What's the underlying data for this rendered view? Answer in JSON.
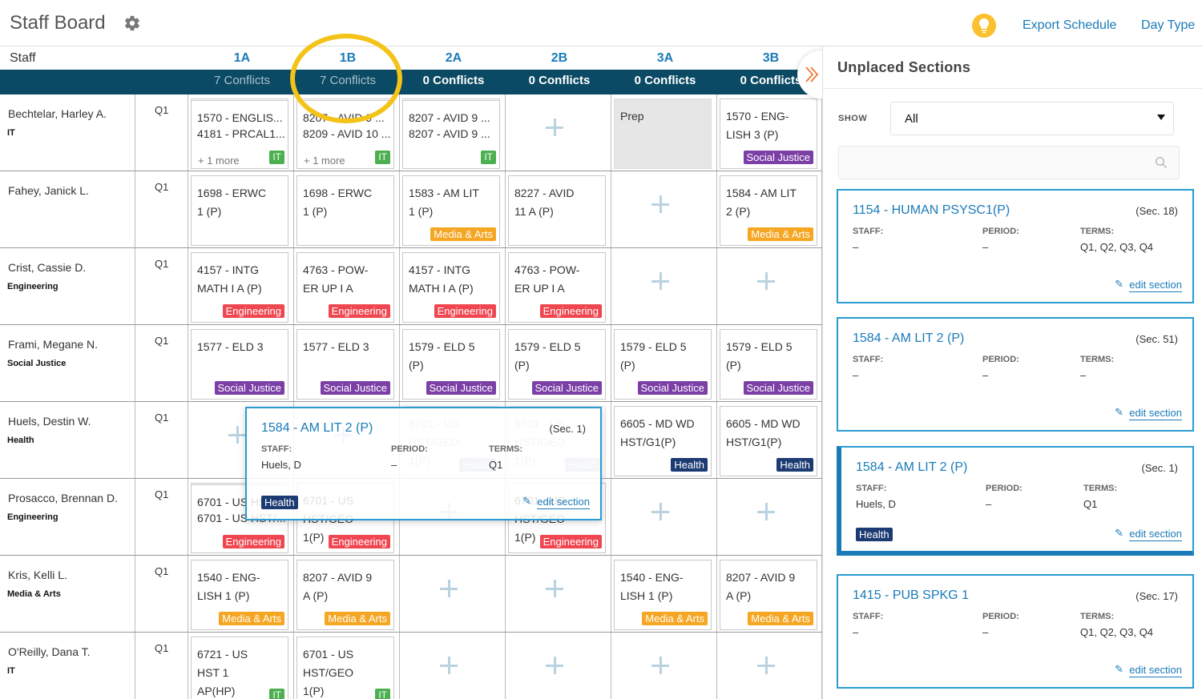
{
  "header": {
    "title": "Staff Board",
    "export_label": "Export Schedule",
    "day_type_label": "Day Type"
  },
  "board": {
    "staff_header": "Staff",
    "columns": [
      {
        "label": "1A",
        "conflicts": "7 Conflicts"
      },
      {
        "label": "1B",
        "conflicts": "7 Conflicts"
      },
      {
        "label": "2A",
        "conflicts": "0 Conflicts"
      },
      {
        "label": "2B",
        "conflicts": "0 Conflicts"
      },
      {
        "label": "3A",
        "conflicts": "0 Conflicts"
      },
      {
        "label": "3B",
        "conflicts": "0 Conflicts"
      }
    ],
    "rows": [
      {
        "name": "Bechtelar, Harley A.",
        "dept": "IT",
        "term": "Q1"
      },
      {
        "name": "Fahey, Janick L.",
        "dept": "",
        "term": "Q1"
      },
      {
        "name": "Crist, Cassie D.",
        "dept": "Engineering",
        "term": "Q1"
      },
      {
        "name": "Frami, Megane N.",
        "dept": "Social Justice",
        "term": "Q1"
      },
      {
        "name": "Huels, Destin W.",
        "dept": "Health",
        "term": "Q1"
      },
      {
        "name": "Prosacco, Brennan D.",
        "dept": "Engineering",
        "term": "Q1"
      },
      {
        "name": "Kris, Kelli L.",
        "dept": "Media & Arts",
        "term": "Q1"
      },
      {
        "name": "O'Reilly, Dana T.",
        "dept": "IT",
        "term": "Q1"
      }
    ],
    "cells": {
      "r0c0": {
        "l1": "1570 - ENGLIS...",
        "l2": "4181 - PRCAL1...",
        "more": "+ 1 more",
        "tag": "IT"
      },
      "r0c1": {
        "l1": "8207 - AVID 9 ...",
        "l2": "8209 - AVID 10 ...",
        "more": "+ 1 more",
        "tag": "IT"
      },
      "r0c2": {
        "l1": "8207 - AVID 9 ...",
        "l2": "8207 - AVID 9 ...",
        "tag": "IT"
      },
      "r0c4": {
        "text": "Prep"
      },
      "r0c5": {
        "text": "1570 - ENG-\nLISH 3 (P)",
        "tag": "Social Justice"
      },
      "r1c0": {
        "text": "1698 - ERWC\n1 (P)"
      },
      "r1c1": {
        "text": "1698 - ERWC\n1 (P)"
      },
      "r1c2": {
        "text": "1583 - AM LIT\n1 (P)",
        "tag": "Media & Arts"
      },
      "r1c3": {
        "text": "8227 - AVID\n11 A (P)"
      },
      "r1c5": {
        "text": "1584 - AM LIT\n2 (P)",
        "tag": "Media & Arts"
      },
      "r2c0": {
        "text": "4157 - INTG\nMATH I A (P)",
        "tag": "Engineering"
      },
      "r2c1": {
        "text": "4763 - POW-\nER UP I A",
        "tag": "Engineering"
      },
      "r2c2": {
        "text": "4157 - INTG\nMATH I A (P)",
        "tag": "Engineering"
      },
      "r2c3": {
        "text": "4763 - POW-\nER UP I A",
        "tag": "Engineering"
      },
      "r3c0": {
        "text": "1577 - ELD 3",
        "tag": "Social Justice"
      },
      "r3c1": {
        "text": "1577 - ELD 3",
        "tag": "Social Justice"
      },
      "r3c2": {
        "text": "1579 - ELD 5\n(P)",
        "tag": "Social Justice"
      },
      "r3c3": {
        "text": "1579 - ELD 5\n(P)",
        "tag": "Social Justice"
      },
      "r3c4": {
        "text": "1579 - ELD 5\n(P)",
        "tag": "Social Justice"
      },
      "r3c5": {
        "text": "1579 - ELD 5\n(P)",
        "tag": "Social Justice"
      },
      "r4c2": {
        "text": "6701 - US\nHST/GEO\n1(P)",
        "tag": "Health"
      },
      "r4c3": {
        "text": "6701 - US\nHST/GEO\n1(P)",
        "tag": "Health"
      },
      "r4c4": {
        "text": "6605 - MD WD\nHST/G1(P)",
        "tag": "Health"
      },
      "r4c5": {
        "text": "6605 - MD WD\nHST/G1(P)",
        "tag": "Health"
      },
      "r5c0": {
        "l1": "6701 - US HST/...",
        "l2": "6701 - US HST/...",
        "tag": "Engineering"
      },
      "r5c1": {
        "text": "6701 - US\nHST/GEO\n1(P)",
        "tag": "Engineering"
      },
      "r5c3": {
        "text": "6701 - US\nHST/GEO\n1(P)",
        "tag": "Engineering"
      },
      "r6c0": {
        "text": "1540 - ENG-\nLISH 1 (P)",
        "tag": "Media & Arts"
      },
      "r6c1": {
        "text": "8207 - AVID 9\nA (P)",
        "tag": "Media & Arts"
      },
      "r6c4": {
        "text": "1540 - ENG-\nLISH 1 (P)",
        "tag": "Media & Arts"
      },
      "r6c5": {
        "text": "8207 - AVID 9\nA (P)",
        "tag": "Media & Arts"
      },
      "r7c0": {
        "text": "6721 - US\nHST 1\nAP(HP)",
        "tag": "IT"
      },
      "r7c1": {
        "text": "6701 - US\nHST/GEO\n1(P)",
        "tag": "IT"
      }
    }
  },
  "popup": {
    "title": "1584 - AM LIT 2 (P)",
    "sec": "(Sec. 1)",
    "staff_label": "STAFF:",
    "staff": "Huels, D",
    "period_label": "PERIOD:",
    "period": "–",
    "terms_label": "TERMS:",
    "terms": "Q1",
    "tag": "Health",
    "edit": "edit section"
  },
  "sidebar": {
    "title": "Unplaced Sections",
    "show_label": "SHOW",
    "show_value": "All",
    "cards": [
      {
        "title": "1154 - HUMAN PSYSC1(P)",
        "sec": "(Sec. 18)",
        "staff_label": "STAFF:",
        "staff": "–",
        "period_label": "PERIOD:",
        "period": "–",
        "terms_label": "TERMS:",
        "terms": "Q1, Q2, Q3, Q4",
        "edit": "edit section"
      },
      {
        "title": "1584 - AM LIT 2 (P)",
        "sec": "(Sec. 51)",
        "staff_label": "STAFF:",
        "staff": "–",
        "period_label": "PERIOD:",
        "period": "–",
        "terms_label": "TERMS:",
        "terms": "–",
        "edit": "edit section"
      },
      {
        "title": "1584 - AM LIT 2 (P)",
        "sec": "(Sec. 1)",
        "staff_label": "STAFF:",
        "staff": "Huels, D",
        "period_label": "PERIOD:",
        "period": "–",
        "terms_label": "TERMS:",
        "terms": "Q1",
        "tag": "Health",
        "edit": "edit section"
      },
      {
        "title": "1415 - PUB SPKG 1",
        "sec": "(Sec. 17)",
        "staff_label": "STAFF:",
        "staff": "–",
        "period_label": "PERIOD:",
        "period": "–",
        "terms_label": "TERMS:",
        "terms": "Q1, Q2, Q3, Q4",
        "edit": "edit section"
      }
    ]
  },
  "colors": {
    "primary": "#1a7bb9",
    "header_bar": "#0b4a64",
    "highlight_ring": "#f3c318",
    "IT": "#4caf50",
    "Social Justice": "#7b3fa6",
    "Media & Arts": "#f5a623",
    "Engineering": "#ef4650",
    "Health": "#1d3b73"
  },
  "icons": {
    "settings": "gear-icon",
    "tip": "lightbulb-icon",
    "toggle": "double-chevron-right-icon",
    "search": "search-icon",
    "edit": "pencil-icon"
  }
}
